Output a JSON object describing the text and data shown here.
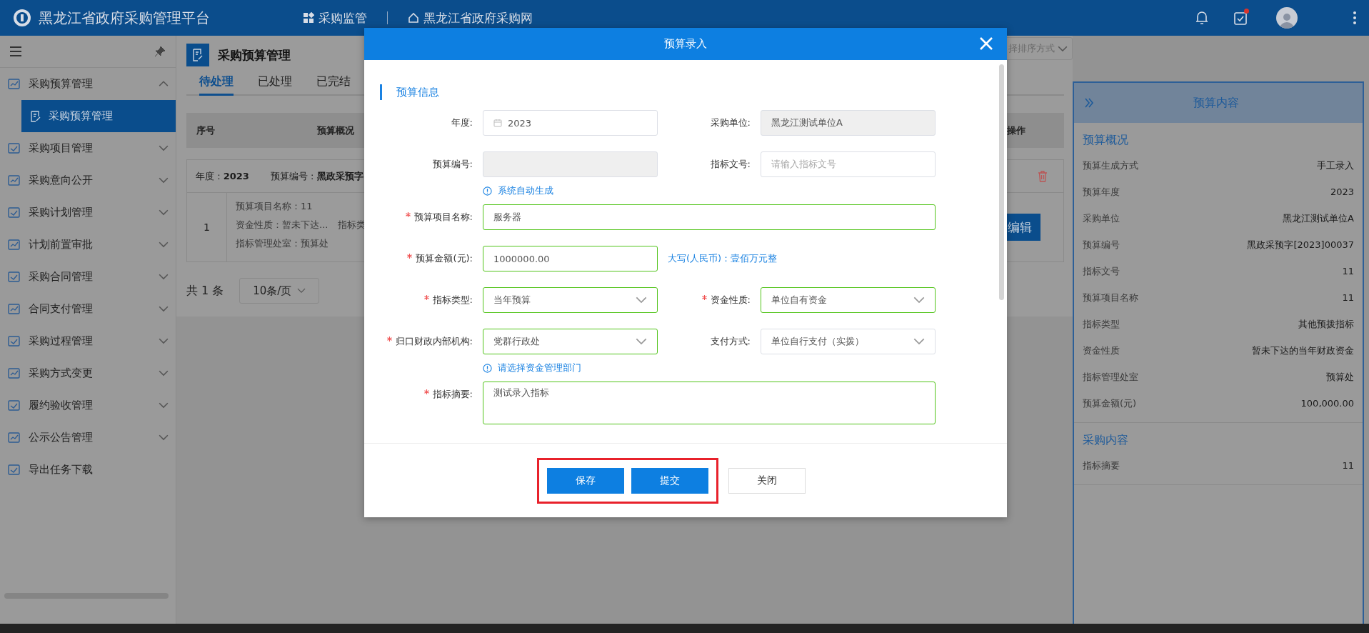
{
  "top_bar": {
    "title": "黑龙江省政府采购管理平台",
    "nav": [
      {
        "kind": "grid",
        "label": "采购监管"
      },
      {
        "kind": "home",
        "label": "黑龙江省政府采购网"
      }
    ],
    "icons": [
      {
        "kind": "bell",
        "unread": false
      },
      {
        "kind": "tasks",
        "unread": true
      }
    ]
  },
  "sidebar": {
    "items": [
      {
        "label": "采购预算管理",
        "expanded": true,
        "children": [
          {
            "label": "采购预算管理",
            "selected": true
          }
        ]
      },
      {
        "label": "采购项目管理",
        "expanded": false
      },
      {
        "label": "采购意向公开",
        "expanded": false
      },
      {
        "label": "采购计划管理",
        "expanded": false
      },
      {
        "label": "计划前置审批",
        "expanded": false
      },
      {
        "label": "采购合同管理",
        "expanded": false
      },
      {
        "label": "合同支付管理",
        "expanded": false
      },
      {
        "label": "采购过程管理",
        "expanded": false
      },
      {
        "label": "采购方式变更",
        "expanded": false
      },
      {
        "label": "履约验收管理",
        "expanded": false
      },
      {
        "label": "公示公告管理",
        "expanded": false
      },
      {
        "label": "导出任务下载",
        "kind": "leaf"
      }
    ]
  },
  "main": {
    "title": "采购预算管理",
    "tabs": [
      {
        "label": "待处理",
        "selected": true
      },
      {
        "label": "已处理",
        "selected": false
      },
      {
        "label": "已完结",
        "selected": false
      }
    ],
    "sort_select": {
      "placeholder": "择排序方式"
    },
    "table": {
      "columns": [
        "序号",
        "预算概况",
        "操作"
      ],
      "groups": [
        {
          "header": [
            "年度 : **2023**",
            "预算编号 : **黑政采预字**"
          ],
          "rows": [
            {
              "index": "1",
              "lines": [
                [
                  "预算项目名称：11"
                ],
                [
                  "资金性质：暂未下达...",
                  "指标类"
                ],
                [
                  "指标管理处室：预算处"
                ]
              ],
              "action": "编辑"
            }
          ]
        }
      ]
    },
    "pagination": {
      "total": "共 1 条",
      "page_size": "10条/页"
    }
  },
  "modal": {
    "title": "预算录入",
    "section": "预算信息",
    "rows": [
      [
        {
          "kind": "date",
          "label": "年度:",
          "required": false,
          "valid": false,
          "disabled": false,
          "value": "2023"
        },
        {
          "kind": "text",
          "label": "采购单位:",
          "required": false,
          "valid": false,
          "disabled": true,
          "value": "黑龙江测试单位A"
        }
      ],
      [
        {
          "kind": "text",
          "label": "预算编号:",
          "required": false,
          "valid": false,
          "disabled": true,
          "hint": "系统自动生成"
        },
        {
          "kind": "text",
          "label": "指标文号:",
          "required": false,
          "valid": false,
          "disabled": false,
          "placeholder": "请输入指标文号"
        }
      ],
      [
        {
          "kind": "text",
          "label": "预算项目名称:",
          "required": true,
          "valid": true,
          "disabled": false,
          "wide": true,
          "value": "服务器"
        }
      ],
      [
        {
          "kind": "text",
          "label": "预算金额(元):",
          "required": true,
          "valid": true,
          "disabled": false,
          "value": "1000000.00",
          "note": "大写(人民币)：壹佰万元整"
        }
      ],
      [
        {
          "kind": "select",
          "label": "指标类型:",
          "required": true,
          "valid": true,
          "disabled": false,
          "value": "当年预算"
        },
        {
          "kind": "select",
          "label": "资金性质:",
          "required": true,
          "valid": true,
          "disabled": false,
          "value": "单位自有资金"
        }
      ],
      [
        {
          "kind": "select",
          "label": "归口财政内部机构:",
          "required": true,
          "valid": true,
          "disabled": false,
          "value": "党群行政处",
          "hint": "请选择资金管理部门"
        },
        {
          "kind": "select",
          "label": "支付方式:",
          "required": false,
          "valid": false,
          "disabled": false,
          "value": "单位自行支付（实拨）"
        }
      ],
      [
        {
          "kind": "textarea",
          "label": "指标摘要:",
          "required": true,
          "valid": true,
          "disabled": false,
          "wide": true,
          "value": "测试录入指标"
        }
      ]
    ],
    "buttons": [
      {
        "label": "保存",
        "kind": "primary",
        "highlighted": true
      },
      {
        "label": "提交",
        "kind": "primary",
        "highlighted": true
      },
      {
        "label": "关闭",
        "kind": "default",
        "highlighted": false
      }
    ]
  },
  "detail_panel": {
    "title": "预算内容",
    "sections": [
      {
        "title": "预算概况",
        "rows": [
          {
            "label": "预算生成方式",
            "value": "手工录入"
          },
          {
            "label": "预算年度",
            "value": "2023"
          },
          {
            "label": "采购单位",
            "value": "黑龙江测试单位A"
          },
          {
            "label": "预算编号",
            "value": "黑政采预字[2023]00037"
          },
          {
            "label": "指标文号",
            "value": "11"
          },
          {
            "label": "预算项目名称",
            "value": "11"
          },
          {
            "label": "指标类型",
            "value": "其他预拨指标"
          },
          {
            "label": "资金性质",
            "value": "暂未下达的当年财政资金"
          },
          {
            "label": "指标管理处室",
            "value": "预算处"
          },
          {
            "label": "预算金额(元)",
            "value": "100,000.00"
          }
        ]
      },
      {
        "title": "采购内容",
        "rows": [
          {
            "label": "指标摘要",
            "value": "11"
          }
        ]
      }
    ]
  }
}
